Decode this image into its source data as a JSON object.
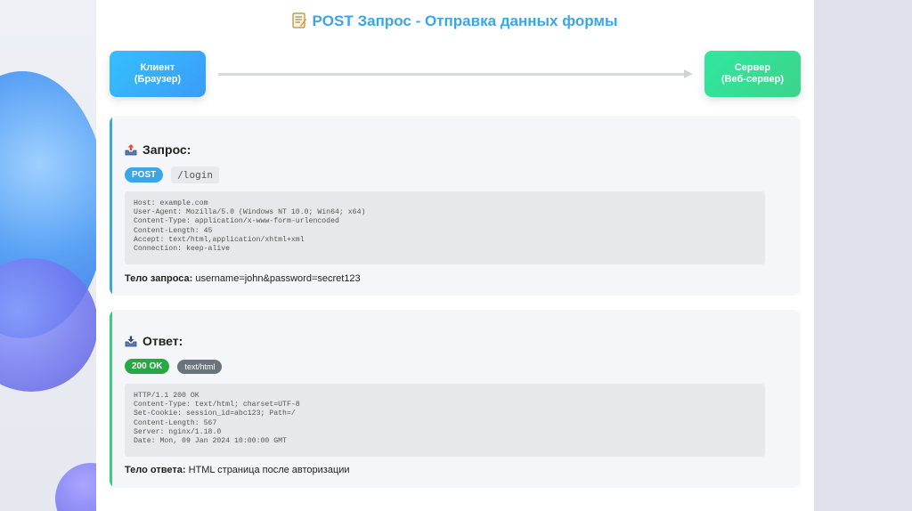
{
  "page": {
    "title": "POST Запрос - Отправка данных формы",
    "title_icon": "memo-icon",
    "accent_color": "#3aa6e8"
  },
  "flow": {
    "client": {
      "line1": "Клиент",
      "line2": "(Браузер)",
      "color": "#34c0ff"
    },
    "server": {
      "line1": "Сервер",
      "line2": "(Веб-сервер)",
      "color": "#2fe8a0"
    }
  },
  "request": {
    "heading": "Запрос:",
    "icon": "outbox-tray-icon",
    "method": "POST",
    "path": "/login",
    "headers": [
      "Host: example.com",
      "User-Agent: Mozilla/5.0 (Windows NT 10.0; Win64; x64)",
      "Content-Type: application/x-www-form-urlencoded",
      "Content-Length: 45",
      "Accept: text/html,application/xhtml+xml",
      "Connection: keep-alive"
    ],
    "body_label": "Тело запроса:",
    "body_value": "username=john&password=secret123"
  },
  "response": {
    "heading": "Ответ:",
    "icon": "inbox-tray-icon",
    "status": "200 OK",
    "mime": "text/html",
    "headers": [
      "HTTP/1.1 200 OK",
      "Content-Type: text/html; charset=UTF-8",
      "Set-Cookie: session_id=abc123; Path=/",
      "Content-Length: 567",
      "Server: nginx/1.18.0",
      "Date: Mon, 09 Jan 2024 10:00:00 GMT"
    ],
    "body_label": "Тело ответа:",
    "body_value": "HTML страница после авторизации"
  }
}
